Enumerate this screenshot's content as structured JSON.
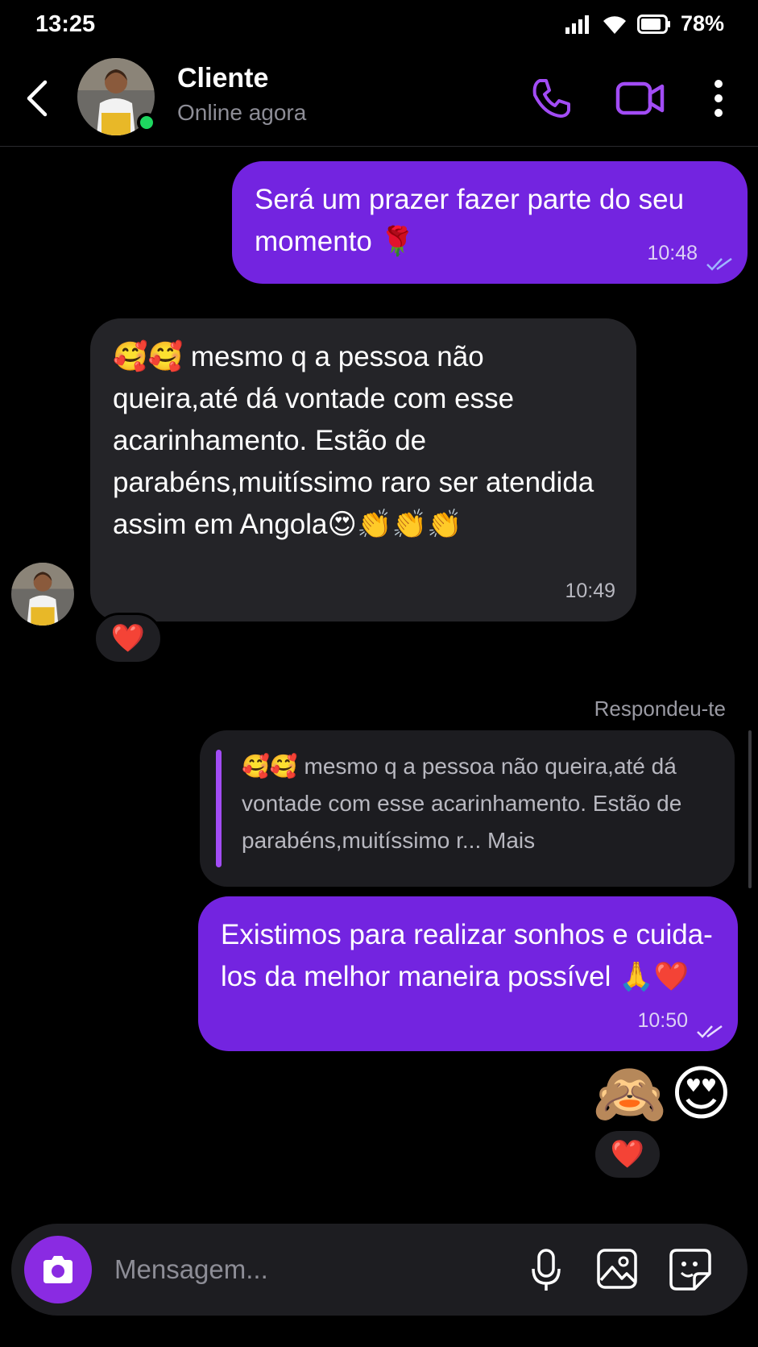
{
  "status_bar": {
    "time": "13:25",
    "battery": "78%"
  },
  "header": {
    "contact_name": "Cliente",
    "contact_status": "Online agora"
  },
  "messages": [
    {
      "text": "Será um prazer fazer parte do seu momento 🌹",
      "time": "10:48"
    },
    {
      "text": "🥰🥰 mesmo q a pessoa não queira,até dá vontade com esse acarinhamento. Estão de parabéns,muitíssimo raro ser atendida assim em Angola😍👏👏👏",
      "time": "10:49",
      "reaction": "❤️"
    },
    {
      "reply_label": "Respondeu-te",
      "quote": "🥰🥰 mesmo q a pessoa não queira,até dá vontade com esse acarinhamento. Estão de parabéns,muitíssimo r... Mais"
    },
    {
      "text": "Existimos para realizar sonhos e cuida-los da melhor maneira possível 🙏❤️",
      "time": "10:50"
    },
    {
      "emojis": "🙈😍",
      "reaction": "❤️"
    }
  ],
  "composer": {
    "placeholder": "Mensagem..."
  },
  "colors": {
    "accent": "#7324e0",
    "icon_accent": "#a24cf5",
    "online": "#1ed760"
  },
  "icons": [
    "back-icon",
    "phone-icon",
    "video-icon",
    "more-icon",
    "camera-icon",
    "mic-icon",
    "gallery-icon",
    "sticker-icon"
  ]
}
